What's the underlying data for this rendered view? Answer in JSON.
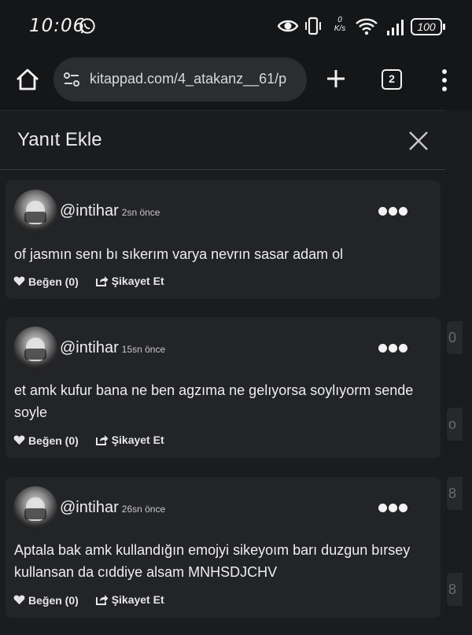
{
  "status_bar": {
    "time": "10:06",
    "battery": "100",
    "net_speed_top": "0",
    "net_speed_unit": "K/s",
    "icons": [
      "whatsapp-icon",
      "eye-icon",
      "vibrate-icon",
      "wifi-icon",
      "signal-icon",
      "battery-icon"
    ]
  },
  "browser": {
    "url": "kitappad.com/4_atakanz__61/p",
    "tab_count": "2"
  },
  "panel": {
    "title": "Yanıt Ekle",
    "comments": [
      {
        "username": "@intihar",
        "time_ago": "2sn önce",
        "text": "of jasmın senı bı sıkerım varya nevrın sasar adam ol",
        "like_label": "Beğen (0)",
        "report_label": "Şikayet Et"
      },
      {
        "username": "@intihar",
        "time_ago": "15sn önce",
        "text": "et amk kufur bana ne ben agzıma ne gelıyorsa soylıyorm sende soyle",
        "like_label": "Beğen (0)",
        "report_label": "Şikayet Et"
      },
      {
        "username": "@intihar",
        "time_ago": "26sn önce",
        "text": "Aptala bak amk kullandığın emojyi sikeyoım barı duzgun bırsey kullansan da cıddiye alsam MNHSDJCHV",
        "like_label": "Beğen (0)",
        "report_label": "Şikayet Et"
      }
    ]
  },
  "background_page": {
    "edge_glyphs": [
      "0",
      "o",
      "8",
      "8"
    ]
  },
  "colors": {
    "background": "#131416",
    "panel": "#1b1c1f",
    "card": "#232427",
    "urlbar": "#2b2d31",
    "text": "#eeeef0"
  }
}
